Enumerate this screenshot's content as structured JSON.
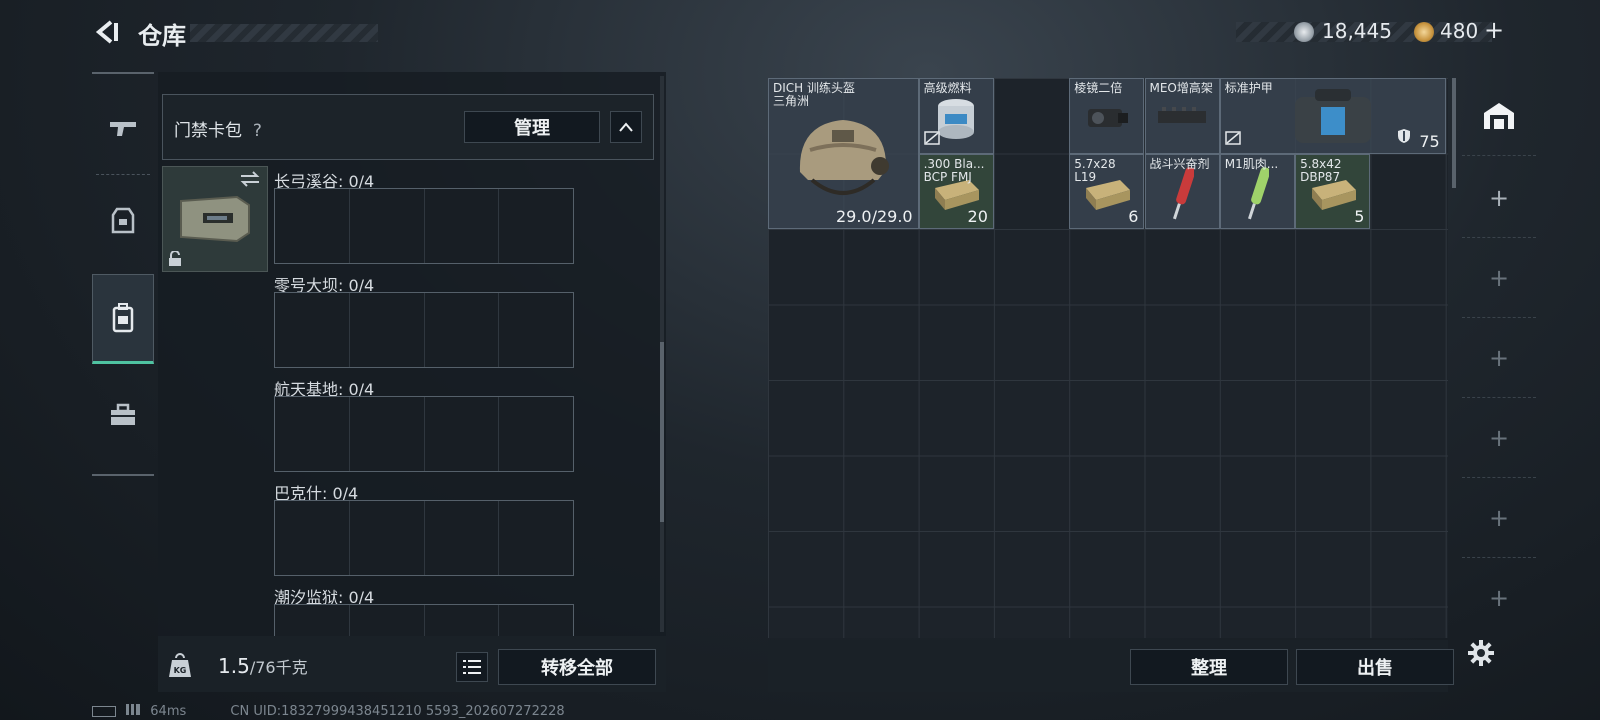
{
  "header": {
    "title": "仓库"
  },
  "currency": {
    "silver": "18,445",
    "gold": "480",
    "gold_plus": "+"
  },
  "sidebar": {
    "items": [
      {
        "icon": "gun-icon"
      },
      {
        "icon": "armor-icon"
      },
      {
        "icon": "backpack-icon"
      },
      {
        "icon": "toolbox-icon"
      }
    ]
  },
  "cardpack": {
    "label": "门禁卡包",
    "help": "?",
    "manage": "管理"
  },
  "slots": [
    {
      "label": "长弓溪谷: 0/4"
    },
    {
      "label": "零号大坝: 0/4"
    },
    {
      "label": "航天基地: 0/4"
    },
    {
      "label": "巴克什: 0/4"
    },
    {
      "label": "潮汐监狱: 0/4"
    }
  ],
  "footer": {
    "weight": "1.5",
    "weight_cap": "/76千克",
    "kg": "KG",
    "transfer_all": "转移全部"
  },
  "items": [
    {
      "name": "DICH 训练头盔",
      "sub": "三角洲",
      "count": "29.0/29.0"
    },
    {
      "name": "高级燃料",
      "count": ""
    },
    {
      "name": "棱镜二倍",
      "count": ""
    },
    {
      "name": "MEO增高架",
      "count": ""
    },
    {
      "name": "标准护甲",
      "count": "75"
    },
    {
      "name": ".300 Bla...",
      "sub": "BCP FMJ",
      "count": "20"
    },
    {
      "name": "5.7x28",
      "sub": "L19",
      "count": "6"
    },
    {
      "name": "战斗兴奋剂",
      "count": ""
    },
    {
      "name": "M1肌肉...",
      "count": ""
    },
    {
      "name": "5.8x42",
      "sub": "DBP87",
      "count": "5"
    }
  ],
  "actions": {
    "sort": "整理",
    "sell": "出售"
  },
  "status": {
    "ping": "64ms",
    "uid": "CN UID:18327999438451210 5593_202607272228"
  },
  "colors": {
    "accent": "#4fc3a1",
    "item_blue": "#3c4856",
    "item_green": "#384e3e"
  }
}
